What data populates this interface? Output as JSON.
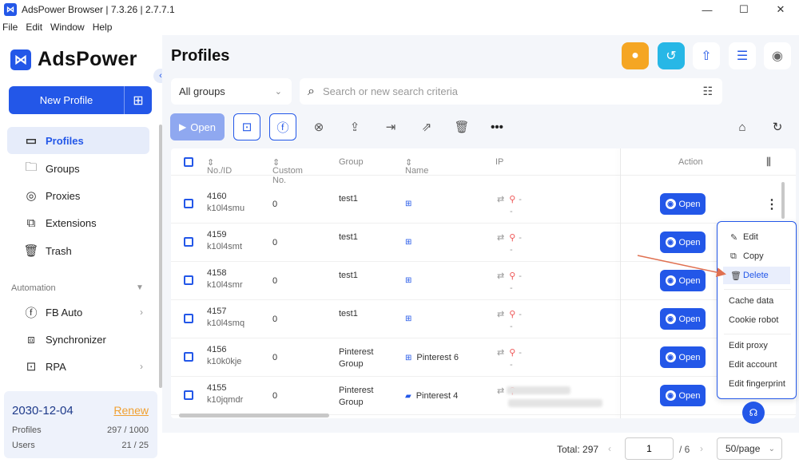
{
  "window": {
    "title": "AdsPower Browser | 7.3.26 | 2.7.7.1",
    "minimize": "—",
    "maximize": "☐",
    "close": "✕"
  },
  "menu": [
    "File",
    "Edit",
    "Window",
    "Help"
  ],
  "brand": {
    "name": "AdsPower"
  },
  "sidebar": {
    "new_profile": "New Profile",
    "items": [
      {
        "label": "Profiles",
        "icon": "profiles-icon"
      },
      {
        "label": "Groups",
        "icon": "folder-icon"
      },
      {
        "label": "Proxies",
        "icon": "globe-icon"
      },
      {
        "label": "Extensions",
        "icon": "puzzle-icon"
      },
      {
        "label": "Trash",
        "icon": "trash-icon"
      }
    ],
    "automation_label": "Automation",
    "automation_items": [
      {
        "label": "FB Auto",
        "icon": "facebook-icon"
      },
      {
        "label": "Synchronizer",
        "icon": "sync-icon"
      },
      {
        "label": "RPA",
        "icon": "robot-icon"
      }
    ]
  },
  "subscription": {
    "date": "2030-12-04",
    "renew": "Renew",
    "profiles_label": "Profiles",
    "profiles_value": "297 / 1000",
    "users_label": "Users",
    "users_value": "21 / 25"
  },
  "page": {
    "title": "Profiles"
  },
  "filters": {
    "group": "All groups",
    "search_placeholder": "Search or new search criteria"
  },
  "toolbar": {
    "open": "Open"
  },
  "table": {
    "headers": {
      "id": "No./ID",
      "custom": "Custom No.",
      "group": "Group",
      "name": "Name",
      "ip": "IP",
      "action": "Action"
    },
    "rows": [
      {
        "no": "4160",
        "id": "k10l4smu",
        "custom": "0",
        "group": "test1",
        "group2": "",
        "name": "",
        "ip": "-",
        "ip2": "-"
      },
      {
        "no": "4159",
        "id": "k10l4smt",
        "custom": "0",
        "group": "test1",
        "group2": "",
        "name": "",
        "ip": "-",
        "ip2": "-"
      },
      {
        "no": "4158",
        "id": "k10l4smr",
        "custom": "0",
        "group": "test1",
        "group2": "",
        "name": "",
        "ip": "-",
        "ip2": "-"
      },
      {
        "no": "4157",
        "id": "k10l4smq",
        "custom": "0",
        "group": "test1",
        "group2": "",
        "name": "",
        "ip": "-",
        "ip2": "-"
      },
      {
        "no": "4156",
        "id": "k10k0kje",
        "custom": "0",
        "group": "Pinterest",
        "group2": "Group",
        "name": "Pinterest 6",
        "ip": "-",
        "ip2": "-"
      },
      {
        "no": "4155",
        "id": "k10jqmdr",
        "custom": "0",
        "group": "Pinterest",
        "group2": "Group",
        "name": "Pinterest 4",
        "ip": "",
        "ip2": ""
      }
    ],
    "open_label": "Open"
  },
  "context_menu": [
    "Edit",
    "Copy",
    "Delete",
    "Cache data",
    "Cookie robot",
    "Edit proxy",
    "Edit account",
    "Edit fingerprint"
  ],
  "footer": {
    "total": "Total: 297",
    "page": "1",
    "of": "/ 6",
    "per_page": "50/page"
  },
  "colors": {
    "accent": "#2357e8",
    "renew": "#f0a030"
  }
}
